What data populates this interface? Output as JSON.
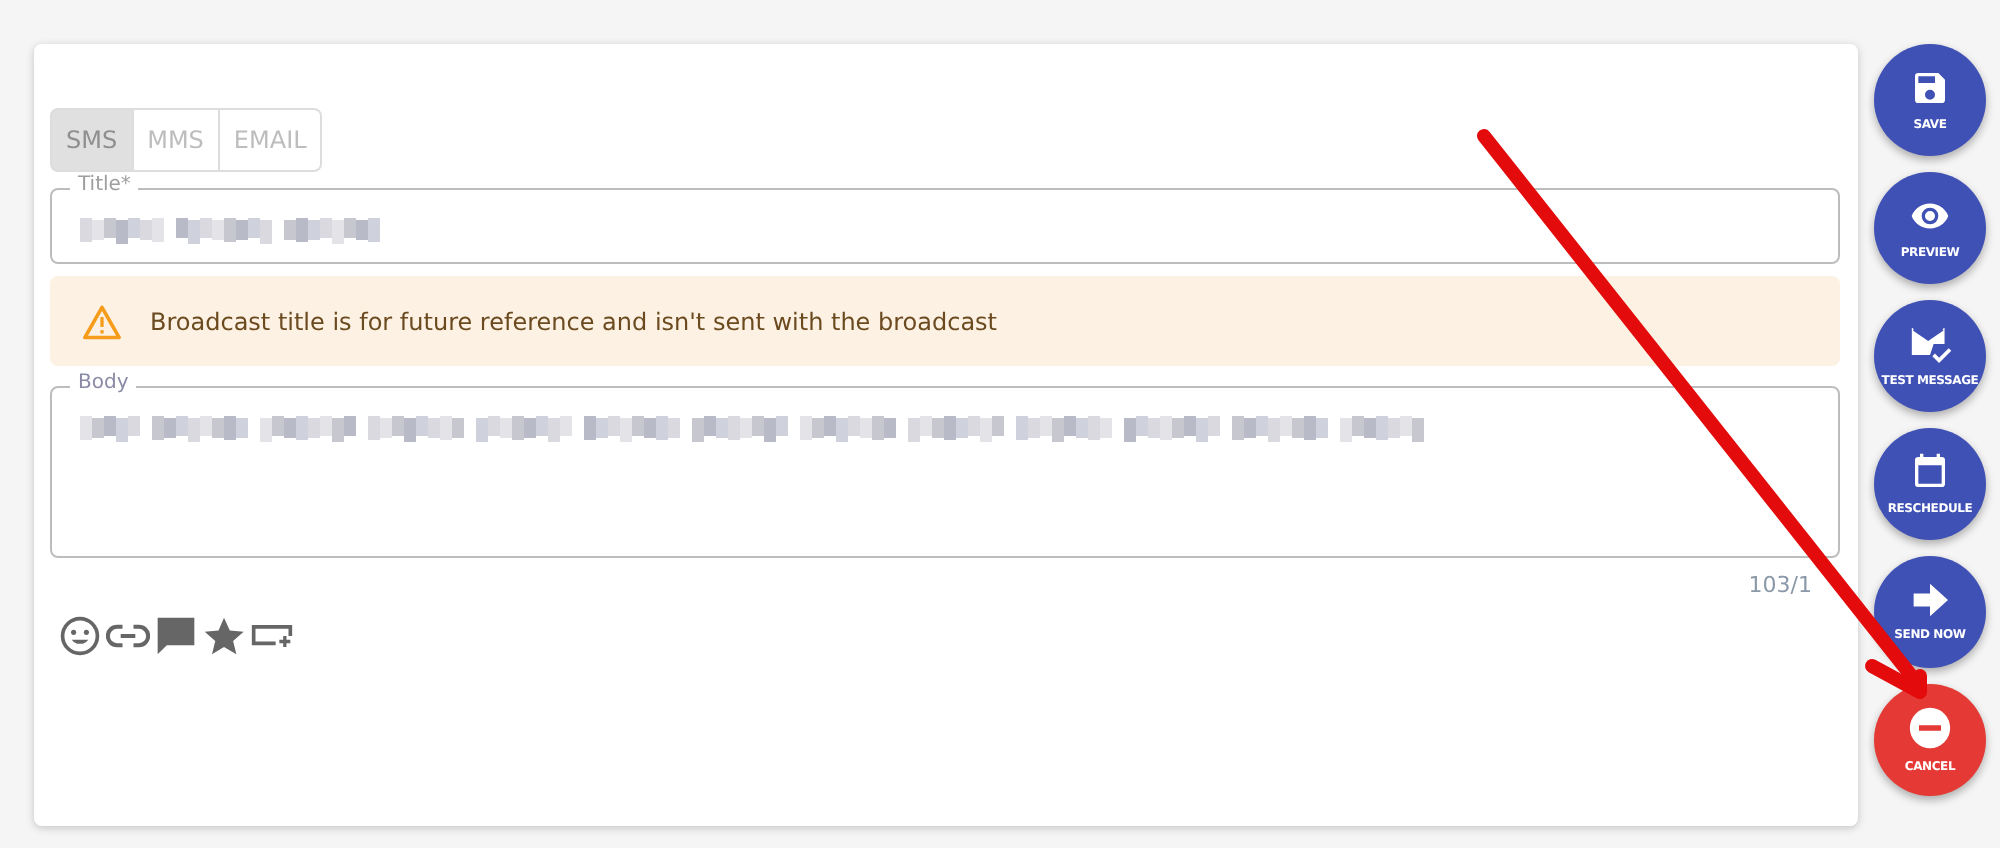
{
  "tabs": [
    {
      "label": "SMS",
      "selected": true
    },
    {
      "label": "MMS",
      "selected": false
    },
    {
      "label": "EMAIL",
      "selected": false
    }
  ],
  "title_field": {
    "label": "Title*"
  },
  "notice": {
    "text": "Broadcast title is for future reference and isn't sent with the broadcast"
  },
  "body_field": {
    "label": "Body",
    "counter": "103/1"
  },
  "actions": [
    {
      "label": "SAVE",
      "kind": "primary"
    },
    {
      "label": "PREVIEW",
      "kind": "primary"
    },
    {
      "label": "TEST MESSAGE",
      "kind": "primary"
    },
    {
      "label": "RESCHEDULE",
      "kind": "primary"
    },
    {
      "label": "SEND NOW",
      "kind": "primary"
    },
    {
      "label": "CANCEL",
      "kind": "danger"
    }
  ]
}
